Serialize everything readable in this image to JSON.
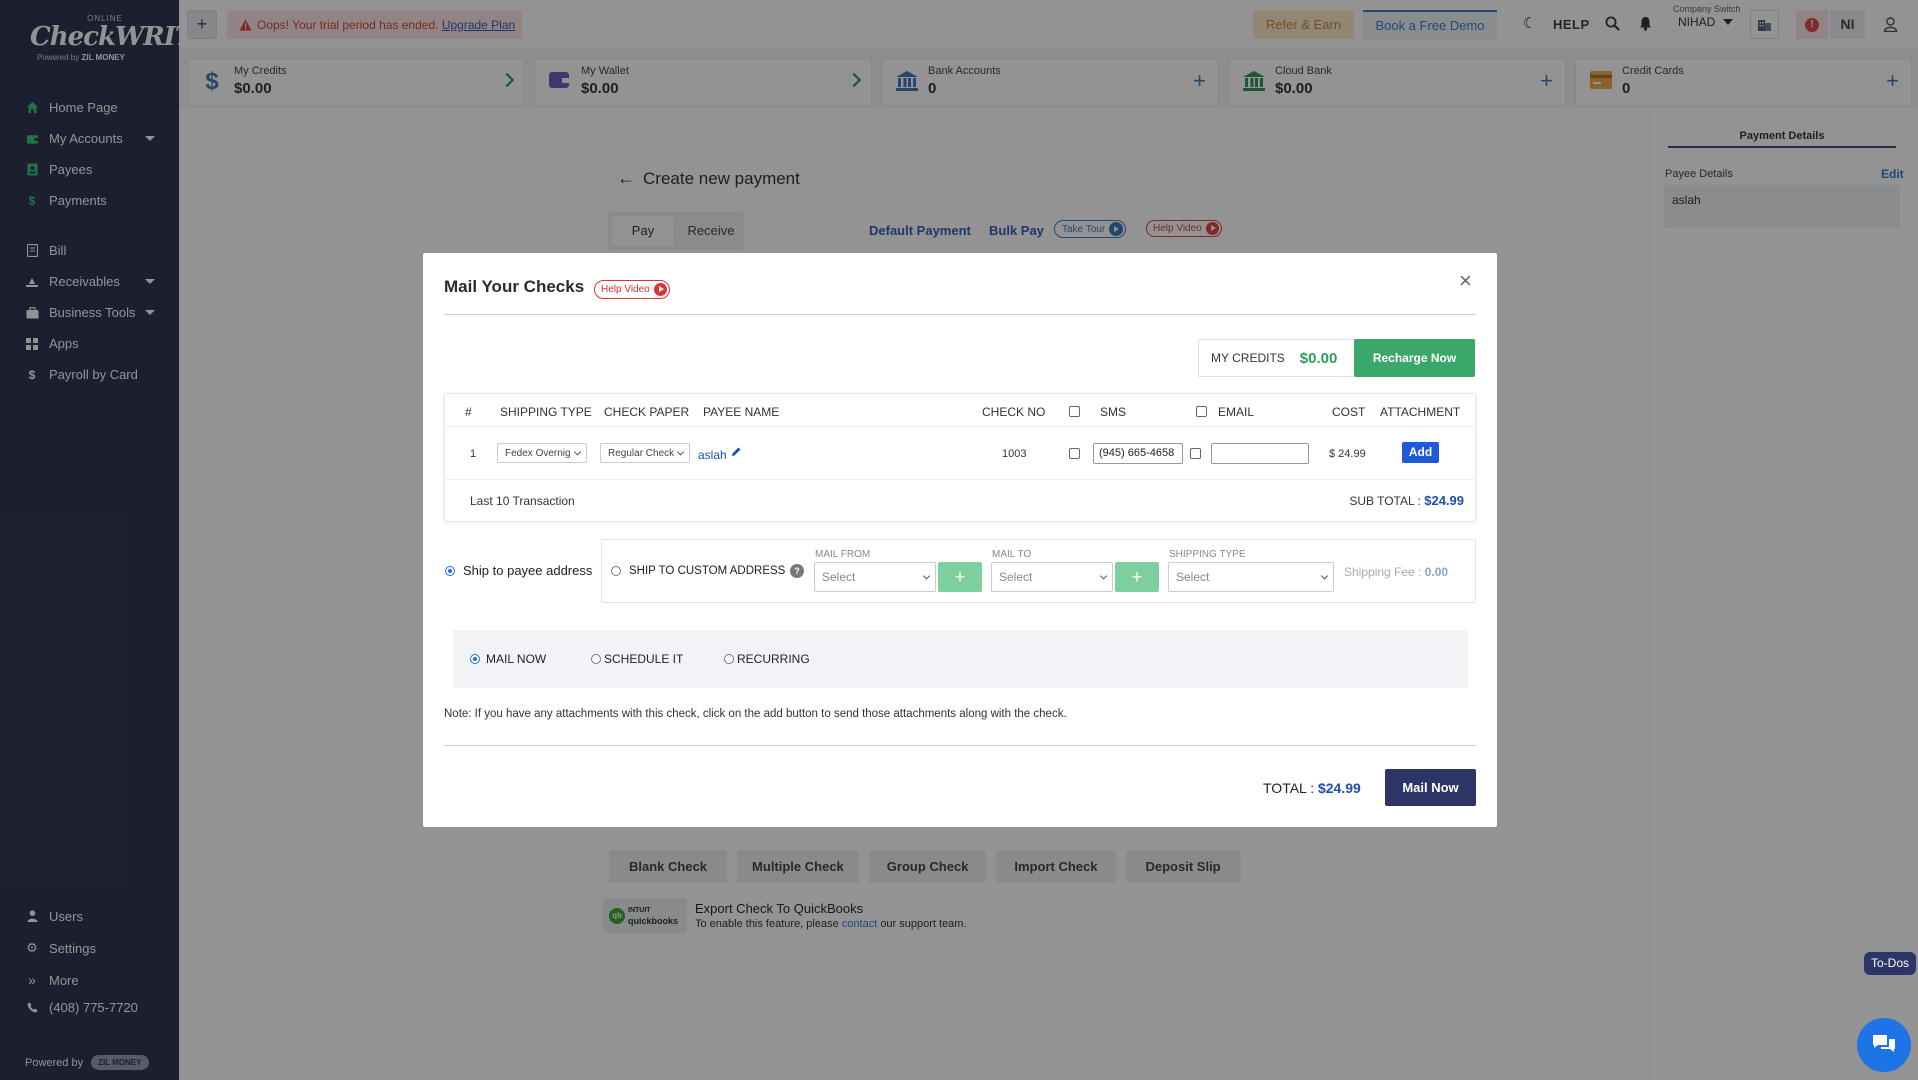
{
  "sidebar": {
    "logo": {
      "top": "ONLINE",
      "main": "CheckWRITER",
      "powered": "Powered by",
      "brand": "ZIL MONEY"
    },
    "items": [
      {
        "label": "Home Page",
        "icon": "home-icon"
      },
      {
        "label": "My Accounts",
        "icon": "wallet-icon"
      },
      {
        "label": "Payees",
        "icon": "payee-icon"
      },
      {
        "label": "Payments",
        "icon": "dollar-icon"
      },
      {
        "label": "Bill",
        "icon": "bill-icon"
      },
      {
        "label": "Receivables",
        "icon": "receivables-icon"
      },
      {
        "label": "Business Tools",
        "icon": "briefcase-icon"
      },
      {
        "label": "Apps",
        "icon": "apps-icon"
      },
      {
        "label": "Payroll by Card",
        "icon": "dollar-icon"
      }
    ],
    "bottom_items": [
      {
        "label": "Users",
        "icon": "user-icon"
      },
      {
        "label": "Settings",
        "icon": "gear-icon"
      },
      {
        "label": "More",
        "icon": "double-chevron-icon"
      },
      {
        "label": "(408) 775-7720",
        "icon": "phone-icon"
      }
    ],
    "powered_by": "Powered by",
    "powered_brand": "ZIL MONEY"
  },
  "topbar": {
    "plus": "+",
    "trial_text": "Oops! Your trial period has ended.",
    "upgrade": "Upgrade Plan",
    "refer": "Refer & Earn",
    "demo": "Book a Free Demo",
    "help": "HELP",
    "company_switch_label": "Company Switch",
    "company": "NIHAD",
    "avatar": "NI"
  },
  "cards": [
    {
      "label": "My Credits",
      "value": "$0.00"
    },
    {
      "label": "My Wallet",
      "value": "$0.00"
    },
    {
      "label": "Bank Accounts",
      "value": "0"
    },
    {
      "label": "Cloud Bank",
      "value": "$0.00"
    },
    {
      "label": "Credit Cards",
      "value": "0"
    }
  ],
  "main": {
    "title": "Create new payment",
    "tabs": [
      "Pay",
      "Receive"
    ],
    "links": [
      "Default Payment",
      "Bulk Pay"
    ],
    "take_tour": "Take Tour",
    "help_video": "Help Video",
    "check_buttons": [
      "Blank Check",
      "Multiple Check",
      "Group Check",
      "Import Check",
      "Deposit Slip"
    ],
    "qb_logo_top": "INTUIT",
    "qb_logo": "quickbooks",
    "qb_title": "Export Check To QuickBooks",
    "qb_text_pre": "To enable this feature, please",
    "qb_link": "contact",
    "qb_text_post": "our support team."
  },
  "rightpanel": {
    "tab": "Payment Details",
    "payee_details": "Payee Details",
    "edit": "Edit",
    "payee": "aslah",
    "todos": "To-Dos"
  },
  "modal": {
    "title": "Mail Your Checks",
    "help_video": "Help Video",
    "close": "×",
    "credits_label": "MY CREDITS",
    "credits_value": "$0.00",
    "recharge": "Recharge Now",
    "columns": {
      "num": "#",
      "shipping": "SHIPPING TYPE",
      "paper": "CHECK PAPER",
      "payee": "PAYEE NAME",
      "checkno": "CHECK NO",
      "sms": "SMS",
      "email": "EMAIL",
      "cost": "COST",
      "attachment": "ATTACHMENT"
    },
    "row": {
      "num": "1",
      "shipping": "Fedex Overnig",
      "paper": "Regular Check",
      "payee": "aslah",
      "checkno": "1003",
      "phone": "(945) 665-4658",
      "email": "",
      "cost": "$ 24.99",
      "attach": "Add"
    },
    "last10": "Last 10 Transaction",
    "subtotal_label": "SUB TOTAL :",
    "subtotal": "$24.99",
    "ship_payee": "Ship to payee address",
    "ship_custom": "SHIP TO CUSTOM ADDRESS",
    "mail_from": "MAIL FROM",
    "mail_to": "MAIL TO",
    "shipping_type": "SHIPPING TYPE",
    "select": "Select",
    "shipping_fee_label": "Shipping Fee :",
    "shipping_fee": "0.00",
    "mail_now_opt": "MAIL NOW",
    "schedule_opt": "SCHEDULE IT",
    "recurring_opt": "RECURRING",
    "note": "Note: If you have any attachments with this check, click on the add button to send those attachments along with the check.",
    "total_label": "TOTAL :",
    "total": "$24.99",
    "mail_now_btn": "Mail Now"
  },
  "colors": {
    "sidebar": "#1b2240",
    "accent_blue": "#2a6fb5",
    "green": "#3aa86b",
    "navy_btn": "#2d3566"
  }
}
